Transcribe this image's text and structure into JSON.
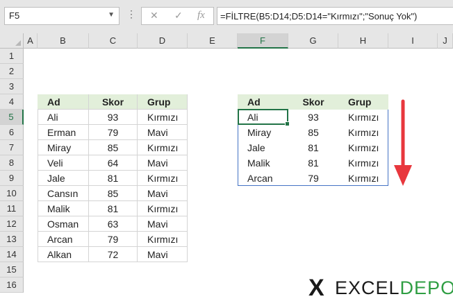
{
  "name_box": "F5",
  "formula_bar": {
    "cancel_icon": "✕",
    "enter_icon": "✓",
    "fx_label": "fx",
    "formula": "=FİLTRE(B5:D14;D5:D14=\"Kırmızı\";\"Sonuç Yok\")"
  },
  "columns": [
    "A",
    "B",
    "C",
    "D",
    "E",
    "F",
    "G",
    "H",
    "I",
    "J"
  ],
  "selected_column": "F",
  "rows": [
    "1",
    "2",
    "3",
    "4",
    "5",
    "6",
    "7",
    "8",
    "9",
    "10",
    "11",
    "12",
    "13",
    "14",
    "15",
    "16"
  ],
  "selected_row": "5",
  "source_table": {
    "headers": [
      "Ad",
      "Skor",
      "Grup"
    ],
    "rows": [
      [
        "Ali",
        "93",
        "Kırmızı"
      ],
      [
        "Erman",
        "79",
        "Mavi"
      ],
      [
        "Miray",
        "85",
        "Kırmızı"
      ],
      [
        "Veli",
        "64",
        "Mavi"
      ],
      [
        "Jale",
        "81",
        "Kırmızı"
      ],
      [
        "Cansın",
        "85",
        "Mavi"
      ],
      [
        "Malik",
        "81",
        "Kırmızı"
      ],
      [
        "Osman",
        "63",
        "Mavi"
      ],
      [
        "Arcan",
        "79",
        "Kırmızı"
      ],
      [
        "Alkan",
        "72",
        "Mavi"
      ]
    ]
  },
  "result_table": {
    "headers": [
      "Ad",
      "Skor",
      "Grup"
    ],
    "rows": [
      [
        "Ali",
        "93",
        "Kırmızı"
      ],
      [
        "Miray",
        "85",
        "Kırmızı"
      ],
      [
        "Jale",
        "81",
        "Kırmızı"
      ],
      [
        "Malik",
        "81",
        "Kırmızı"
      ],
      [
        "Arcan",
        "79",
        "Kırmızı"
      ]
    ]
  },
  "arrow_color": "#e8373d",
  "logo": {
    "part1": "EXCEL",
    "part2": "DEPO"
  }
}
